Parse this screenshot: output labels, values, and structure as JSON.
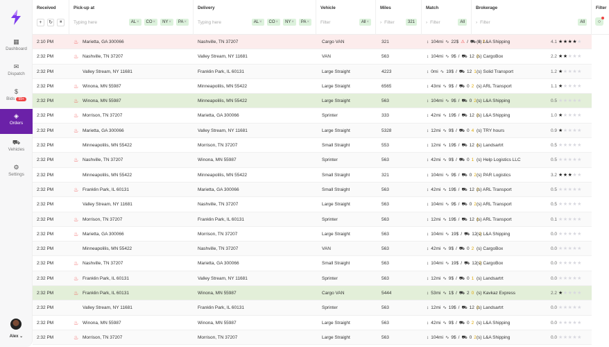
{
  "sidebar": {
    "items": [
      {
        "label": "Dashboard",
        "icon": "grid-icon"
      },
      {
        "label": "Dispatch",
        "icon": "mail-icon"
      },
      {
        "label": "Bids",
        "icon": "dollar-icon",
        "badge": "99+"
      },
      {
        "label": "Orders",
        "icon": "layers-icon",
        "active": true
      },
      {
        "label": "Vehicles",
        "icon": "vehicle-icon"
      },
      {
        "label": "Settings",
        "icon": "gear-icon"
      }
    ],
    "user": "Alex"
  },
  "header": {
    "received": "Received",
    "pickup": "Pick-up at",
    "delivery": "Delivery",
    "vehicle": "Vehicle",
    "miles": "Miles",
    "match": "Match",
    "brokerage": "Brokerage",
    "filter": "Filter",
    "pickup_placeholder": "Typing here",
    "delivery_placeholder": "Typing here",
    "filter_placeholder": "Filter",
    "pickup_chips": [
      "AL",
      "CO",
      "NY",
      "PA"
    ],
    "delivery_chips": [
      "AL",
      "CO",
      "NY",
      "PA"
    ],
    "vehicle_chip": "All",
    "miles_chip": "321",
    "match_chip": "All",
    "brokerage_chip": "All"
  },
  "rows": [
    [
      "2:10 PM",
      1,
      "Marietta, GA 300066",
      "Nashville, TN 37207",
      "Cargo VAN",
      "321",
      "104mi",
      "22$",
      "8",
      "2",
      "(s) L&A Shipping",
      "4.1",
      4,
      "pink",
      1
    ],
    [
      "2:32 PM",
      1,
      "Nashville, TN 37207",
      "Valley Stream, NY 11681",
      "VAN",
      "563",
      "104mi",
      "9$",
      "12",
      "2",
      "(s) CargoBox",
      "2.2",
      2,
      "",
      0
    ],
    [
      "2:32 PM",
      0,
      "Valley Stream, NY 11681",
      "Franklin Park, IL 60131",
      "Large  Straight",
      "4223",
      "0mi",
      "19$",
      "12",
      "1",
      "(s) Solid Transport",
      "1.2",
      1,
      "",
      0
    ],
    [
      "2:32 PM",
      1,
      "Winona, MN 55987",
      "Minneapolilis, MN 55422",
      "Large Straight",
      "6565",
      "43mi",
      "9$",
      "0",
      "2",
      "(s) ARL Transport",
      "1.1",
      1,
      "",
      0
    ],
    [
      "2:32 PM",
      1,
      "Winona, MN 55987",
      "Minneapolilis, MN 55422",
      "Large Straight",
      "563",
      "104mi",
      "9$",
      "0",
      "2",
      "(s) L&A Shipping",
      "0.5",
      0,
      "green",
      0
    ],
    [
      "2:32 PM",
      1,
      "Morrison, TN 37207",
      "Marietta, GA 300066",
      "Sprinter",
      "333",
      "42mi",
      "19$",
      "12",
      "2",
      "(s) L&A Shipping",
      "1.0",
      1,
      "",
      0
    ],
    [
      "2:32 PM",
      1,
      "Marietta, GA 300066",
      "Valley Stream, NY 11681",
      "Large Straight",
      "5328",
      "12mi",
      "9$",
      "0",
      "4",
      "(s) TRY hours",
      "0.9",
      1,
      "",
      0
    ],
    [
      "2:32 PM",
      0,
      "Minneapolilis, MN 55422",
      "Morrison, TN 37207",
      "Small Straight",
      "553",
      "12mi",
      "19$",
      "12",
      "1",
      "(s) Landsartrt",
      "0.5",
      0,
      "",
      0
    ],
    [
      "2:32 PM",
      1,
      "Nashville, TN 37207",
      "Winona, MN 55987",
      "Sprinter",
      "563",
      "42mi",
      "9$",
      "0",
      "1",
      "(s) Help Logistics LLC",
      "0.5",
      0,
      "",
      0
    ],
    [
      "2:32 PM",
      0,
      "Minneapolilis, MN 55422",
      "Minneapolilis, MN 55422",
      "Small Straight",
      "321",
      "104mi",
      "9$",
      "0",
      "2",
      "(s) PAR Logistics",
      "3.2",
      3,
      "",
      0
    ],
    [
      "2:32 PM",
      1,
      "Franklin Park, IL 60131",
      "Marietta, GA 300066",
      "Small Straight",
      "563",
      "42mi",
      "19$",
      "12",
      "2",
      "(s) ARL Transport",
      "0.5",
      0,
      "",
      0
    ],
    [
      "2:32 PM",
      0,
      "Valley Stream, NY 11681",
      "Nashville, TN 37207",
      "Large Straight",
      "563",
      "104mi",
      "9$",
      "0",
      "2",
      "(s) ARL Transport",
      "0.5",
      0,
      "",
      0
    ],
    [
      "2:32 PM",
      1,
      "Morrison, TN 37207",
      "Franklin Park, IL 60131",
      "Sprinter",
      "563",
      "12mi",
      "19$",
      "12",
      "1",
      "(s) ARL Transport",
      "0.1",
      0,
      "",
      0
    ],
    [
      "2:32 PM",
      1,
      "Marietta, GA 300066",
      "Morrison, TN 37207",
      "Large Straight",
      "563",
      "104mi",
      "19$",
      "12",
      "2",
      "(s) L&A Shipping",
      "0.0",
      0,
      "",
      0
    ],
    [
      "2:32 PM",
      0,
      "Minneapolilis, MN 55422",
      "Nashville, TN 37207",
      "VAN",
      "563",
      "42mi",
      "9$",
      "0",
      "2",
      "(s) CargoBox",
      "0.0",
      0,
      "",
      0
    ],
    [
      "2:32 PM",
      1,
      "Nashville, TN 37207",
      "Marietta, GA 300066",
      "Small Straight",
      "563",
      "104mi",
      "19$",
      "12",
      "2",
      "(s) CargoBox",
      "0.0",
      0,
      "",
      0
    ],
    [
      "2:32 PM",
      1,
      "Franklin Park, IL 60131",
      "Valley Stream, NY 11681",
      "Sprinter",
      "563",
      "12mi",
      "9$",
      "0",
      "1",
      "(s) Landsartrt",
      "0.0",
      0,
      "",
      0
    ],
    [
      "2:32 PM",
      1,
      "Franklin Park, IL 60131",
      "Winona, MN 55987",
      "Cargo VAN",
      "5444",
      "53mi",
      "1$",
      "2",
      "0",
      "(s) Kavkaz Express",
      "2.2",
      1,
      "green",
      0
    ],
    [
      "2:32 PM",
      0,
      "Valley Stream, NY 11681",
      "Franklin Park, IL 60131",
      "Sprinter",
      "563",
      "12mi",
      "19$",
      "12",
      "2",
      "(s) Landsartrt",
      "0.0",
      0,
      "",
      0
    ],
    [
      "2:32 PM",
      1,
      "Winona, MN 55987",
      "Winona, MN 55987",
      "Large Straight",
      "563",
      "42mi",
      "9$",
      "0",
      "2",
      "(s) L&A Shipping",
      "0.0",
      0,
      "",
      0
    ],
    [
      "2:32 PM",
      1,
      "Morrison, TN 37207",
      "Morrison, TN 37207",
      "Large Straight",
      "563",
      "104mi",
      "9$",
      "0",
      "2",
      "(s) L&A Shipping",
      "0.0",
      0,
      "",
      0
    ]
  ]
}
